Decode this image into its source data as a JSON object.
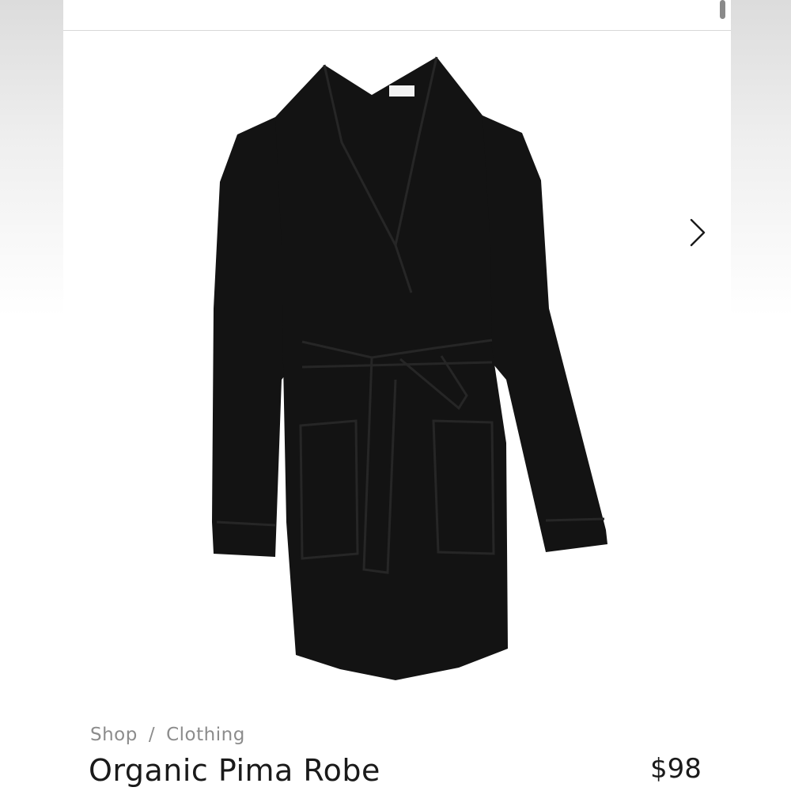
{
  "breadcrumb": {
    "shop": "Shop",
    "separator": "/",
    "clothing": "Clothing"
  },
  "product": {
    "title": "Organic Pima Robe",
    "price": "$98",
    "image_icon": "robe-image"
  },
  "gallery": {
    "next_icon": "chevron-right-icon"
  },
  "colors": {
    "robe": "#131313",
    "breadcrumb": "#8c8c8c",
    "text": "#1a1a1a"
  }
}
